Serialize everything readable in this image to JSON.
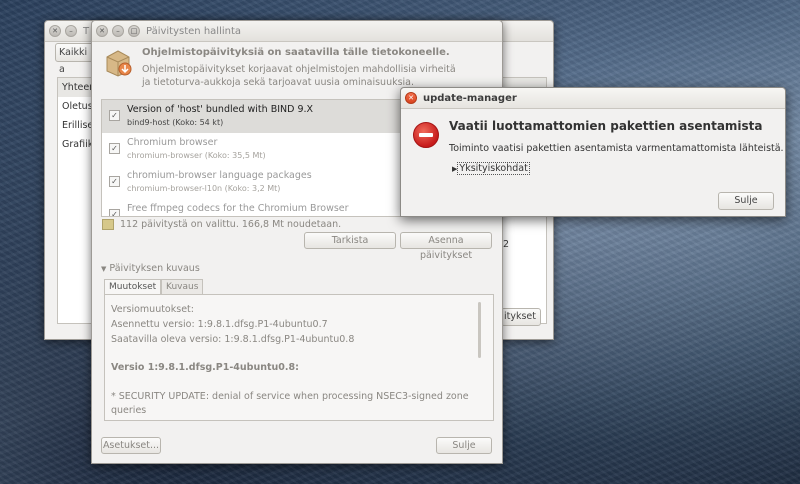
{
  "back_window": {
    "title": "T",
    "button": "Kaikki a",
    "list_items": [
      "Yhteen",
      "Oletus",
      "Erillise",
      "Grafiik"
    ],
    "side_fragment": "2",
    "bottom_button": "itykset"
  },
  "main_window": {
    "title": "Päivitysten hallinta",
    "header_title": "Ohjelmistopäivityksiä on saatavilla tälle tietokoneelle.",
    "header_text": "Ohjelmistopäivitykset korjaavat ohjelmistojen mahdollisia virheitä ja tietoturva-aukkoja sekä tarjoavat uusia ominaisuuksia.",
    "packages": [
      {
        "name": "Version of 'host' bundled with BIND 9.X",
        "sub": "bind9-host (Koko: 54 kt)",
        "checked": true,
        "selected": true
      },
      {
        "name": "Chromium browser",
        "sub": "chromium-browser (Koko: 35,5 Mt)",
        "checked": true,
        "selected": false
      },
      {
        "name": "chromium-browser language packages",
        "sub": "chromium-browser-l10n (Koko: 3,2 Mt)",
        "checked": true,
        "selected": false
      },
      {
        "name": "Free ffmpeg codecs for the Chromium Browser",
        "sub": "",
        "checked": true,
        "selected": false
      }
    ],
    "summary": "112 päivitystä on valittu. 166,8 Mt noudetaan.",
    "check_button": "Tarkista",
    "install_button": "Asenna päivitykset",
    "desc_expander": "Päivityksen kuvaus",
    "tabs": [
      "Muutokset",
      "Kuvaus"
    ],
    "desc_lines": [
      "Versiomuutokset:",
      "Asennettu versio: 1:9.8.1.dfsg.P1-4ubuntu0.7",
      "Saatavilla oleva versio: 1:9.8.1.dfsg.P1-4ubuntu0.8",
      "Versio 1:9.8.1.dfsg.P1-4ubuntu0.8:",
      " * SECURITY UPDATE: denial of service when processing NSEC3-signed zone",
      "   queries"
    ],
    "settings_button": "Asetukset...",
    "close_button": "Sulje"
  },
  "dialog": {
    "title": "update-manager",
    "heading": "Vaatii luottamattomien pakettien asentamista",
    "body": "Toiminto vaatisi pakettien asentamista varmentamattomista lähteistä.",
    "details_expander": "Yksityiskohdat",
    "close_button": "Sulje"
  },
  "colors": {
    "stop_red": "#c71b1b",
    "close_orange": "#e0532b"
  }
}
